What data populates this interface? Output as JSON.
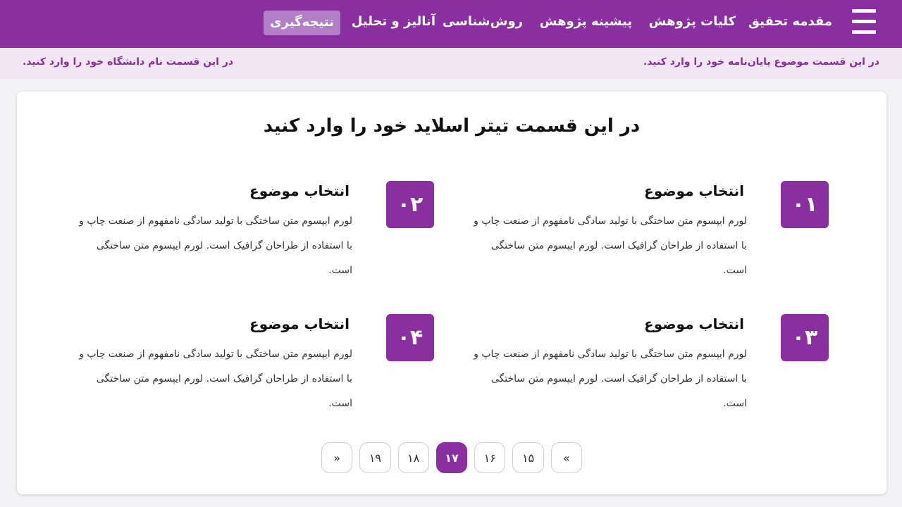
{
  "nav": {
    "menu_icon": "hamburger-menu-icon",
    "items": [
      {
        "label": "مقدمه تحقیق",
        "active": false
      },
      {
        "label": "کلیات پژوهش",
        "active": false
      },
      {
        "label": "پیشینه پژوهش",
        "active": false
      },
      {
        "label": "روش‌شناسی",
        "active": false
      },
      {
        "label": "آنالیز و تحلیل",
        "active": false
      },
      {
        "label": "نتیجه‌گیری",
        "active": true
      }
    ]
  },
  "subbar": {
    "topic_text": "در این قسمت موضوع پایان‌نامه خود را وارد کنید.",
    "university_text": "در این قسمت نام دانشگاه خود را وارد کنید."
  },
  "slide": {
    "title": "در این قسمت تیتر اسلاید خود را وارد کنید",
    "items": [
      {
        "number": "۰۱",
        "title": "انتخاب موضوع",
        "description": "لورم ایپسوم متن ساختگی با تولید سادگی نامفهوم از صنعت چاپ و با استفاده از طراحان گرافیک است.  لورم ایپسوم متن ساختگی است."
      },
      {
        "number": "۰۲",
        "title": "انتخاب موضوع",
        "description": "لورم ایپسوم متن ساختگی با تولید سادگی نامفهوم از صنعت چاپ و با استفاده از طراحان گرافیک است.  لورم ایپسوم متن ساختگی است."
      },
      {
        "number": "۰۳",
        "title": "انتخاب موضوع",
        "description": "لورم ایپسوم متن ساختگی با تولید سادگی نامفهوم از صنعت چاپ و با استفاده از طراحان گرافیک است.  لورم ایپسوم متن ساختگی است."
      },
      {
        "number": "۰۴",
        "title": "انتخاب موضوع",
        "description": "لورم ایپسوم متن ساختگی با تولید سادگی نامفهوم از صنعت چاپ و با استفاده از طراحان گرافیک است.  لورم ایپسوم متن ساختگی است."
      }
    ]
  },
  "pagination": {
    "prev_label": "«",
    "next_label": "»",
    "pages": [
      "۱۵",
      "۱۶",
      "۱۷",
      "۱۸",
      "۱۹"
    ],
    "current": "۱۷"
  },
  "colors": {
    "primary": "#8a2f9f",
    "active_tab": "#b27fc6",
    "subbar_bg": "#f3e7f6"
  }
}
